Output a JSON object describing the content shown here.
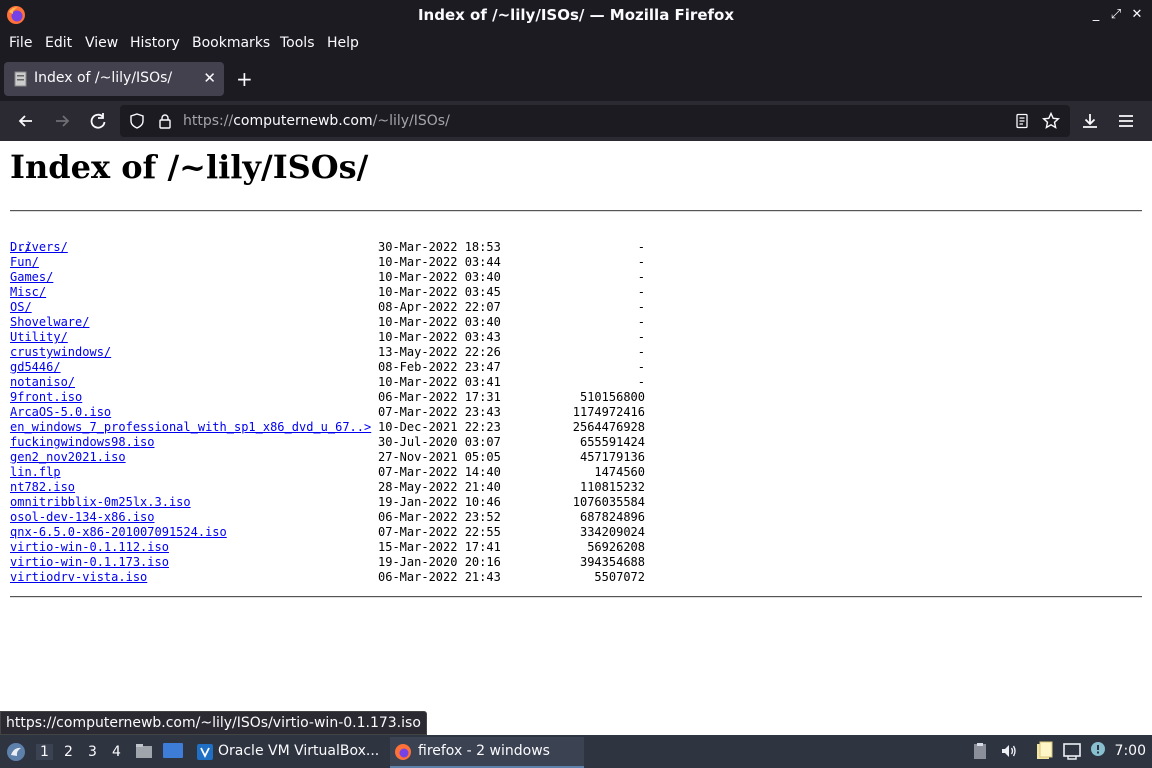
{
  "window": {
    "title": "Index of /~lily/ISOs/ — Mozilla Firefox"
  },
  "menu": [
    "File",
    "Edit",
    "View",
    "History",
    "Bookmarks",
    "Tools",
    "Help"
  ],
  "tab": {
    "title": "Index of /~lily/ISOs/"
  },
  "url": {
    "prefix": "https://",
    "domain": "computernewb.com",
    "path": "/~lily/ISOs/"
  },
  "page": {
    "heading": "Index of /~lily/ISOs/",
    "parent": "../",
    "entries": [
      {
        "name": "Drivers/",
        "date": "30-Mar-2022 18:53",
        "size": "-"
      },
      {
        "name": "Fun/",
        "date": "10-Mar-2022 03:44",
        "size": "-"
      },
      {
        "name": "Games/",
        "date": "10-Mar-2022 03:40",
        "size": "-"
      },
      {
        "name": "Misc/",
        "date": "10-Mar-2022 03:45",
        "size": "-"
      },
      {
        "name": "OS/",
        "date": "08-Apr-2022 22:07",
        "size": "-"
      },
      {
        "name": "Shovelware/",
        "date": "10-Mar-2022 03:40",
        "size": "-"
      },
      {
        "name": "Utility/",
        "date": "10-Mar-2022 03:43",
        "size": "-"
      },
      {
        "name": "crustywindows/",
        "date": "13-May-2022 22:26",
        "size": "-"
      },
      {
        "name": "gd5446/",
        "date": "08-Feb-2022 23:47",
        "size": "-"
      },
      {
        "name": "notaniso/",
        "date": "10-Mar-2022 03:41",
        "size": "-"
      },
      {
        "name": "9front.iso",
        "date": "06-Mar-2022 17:31",
        "size": "510156800"
      },
      {
        "name": "ArcaOS-5.0.iso",
        "date": "07-Mar-2022 23:43",
        "size": "1174972416"
      },
      {
        "name": "en_windows_7_professional_with_sp1_x86_dvd_u_67..>",
        "date": "10-Dec-2021 22:23",
        "size": "2564476928"
      },
      {
        "name": "fuckingwindows98.iso",
        "date": "30-Jul-2020 03:07",
        "size": "655591424"
      },
      {
        "name": "gen2_nov2021.iso",
        "date": "27-Nov-2021 05:05",
        "size": "457179136"
      },
      {
        "name": "lin.flp",
        "date": "07-Mar-2022 14:40",
        "size": "1474560"
      },
      {
        "name": "nt782.iso",
        "date": "28-May-2022 21:40",
        "size": "110815232"
      },
      {
        "name": "omnitribblix-0m25lx.3.iso",
        "date": "19-Jan-2022 10:46",
        "size": "1076035584"
      },
      {
        "name": "osol-dev-134-x86.iso",
        "date": "06-Mar-2022 23:52",
        "size": "687824896"
      },
      {
        "name": "qnx-6.5.0-x86-201007091524.iso",
        "date": "07-Mar-2022 22:55",
        "size": "334209024"
      },
      {
        "name": "virtio-win-0.1.112.iso",
        "date": "15-Mar-2022 17:41",
        "size": "56926208"
      },
      {
        "name": "virtio-win-0.1.173.iso",
        "date": "19-Jan-2020 20:16",
        "size": "394354688"
      },
      {
        "name": "virtiodrv-vista.iso",
        "date": "06-Mar-2022 21:43",
        "size": "5507072"
      }
    ]
  },
  "status": {
    "link": "https://computernewb.com/~lily/ISOs/virtio-win-0.1.173.iso"
  },
  "taskbar": {
    "workspaces": [
      "1",
      "2",
      "3",
      "4"
    ],
    "tasks": [
      "Oracle VM VirtualBox...",
      "firefox - 2 windows"
    ],
    "clock": "7:00"
  },
  "colors": {
    "chrome_dark": "#1c1b22",
    "toolbar": "#2b2a33",
    "tab_active": "#42414d",
    "link": "#0000ee",
    "taskbar": "#2e3440"
  }
}
